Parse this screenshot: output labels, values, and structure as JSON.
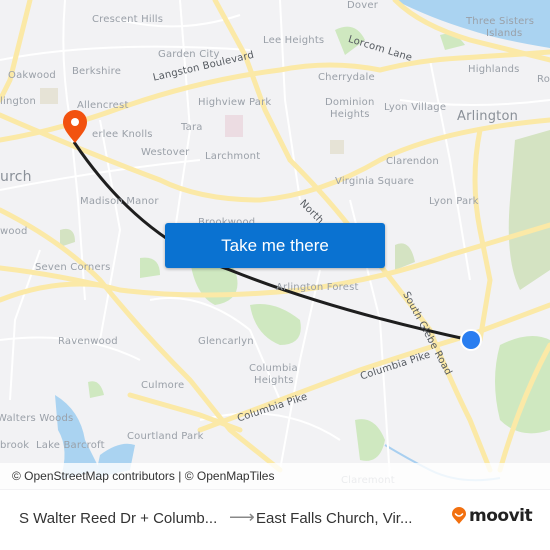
{
  "map": {
    "labels": {
      "crescent_hills": "Crescent Hills",
      "garden_city": "Garden City",
      "oakwood": "Oakwood",
      "berkshire": "Berkshire",
      "arlington_w": "lington",
      "allencrest": "Allencrest",
      "langston": "Langston Boulevard",
      "highview_park": "Highview Park",
      "tara": "Tara",
      "westover": "Westover",
      "larchmont": "Larchmont",
      "leeherlee": "erlee Knolls",
      "church": "urch",
      "madison_manor": "Madison Manor",
      "brookwood": "Brookwood",
      "wood_w": "wood",
      "seven_corners": "Seven Corners",
      "dover": "Dover",
      "lee_heights": "Lee Heights",
      "lorcom": "Lorcom Lane",
      "three_sisters": "Three Sisters",
      "islands": "Islands",
      "highlands": "Highlands",
      "ro": "Ro",
      "cherrydale": "Cherrydale",
      "dominion": "Dominion",
      "heights": "Heights",
      "lyon_village": "Lyon Village",
      "arlington": "Arlington",
      "clarendon": "Clarendon",
      "virginia_square": "Virginia Square",
      "lyon_park": "Lyon Park",
      "north_g": "North G",
      "arlington_forest": "Arlington Forest",
      "south_glebe": "South Glebe Road",
      "ravenwood": "Ravenwood",
      "glencarlyn": "Glencarlyn",
      "columbia": "Columbia",
      "columbia_heights2": "Heights",
      "culmore": "Culmore",
      "columbia_pike_1": "Columbia Pike",
      "columbia_pike_2": "Columbia Pike",
      "walters_woods": "Walters Woods",
      "lake_barcroft": "Lake Barcroft",
      "brook": "brook",
      "courtland_park": "Courtland Park",
      "claremont": "Claremont",
      "pike": "Pike"
    },
    "origin_marker": "blue-dot",
    "destination_marker": "orange-pin",
    "colors": {
      "route": "#1e1e1e",
      "origin": "#2a7ef0",
      "destination": "#f2520f",
      "button": "#0a72d1"
    }
  },
  "cta": {
    "label": "Take me there"
  },
  "attribution": "© OpenStreetMap contributors | © OpenMapTiles",
  "footer": {
    "from": "S Walter Reed Dr + Columb...",
    "arrow": "⟶",
    "to": "East Falls Church, Vir...",
    "brand": "moovit"
  }
}
